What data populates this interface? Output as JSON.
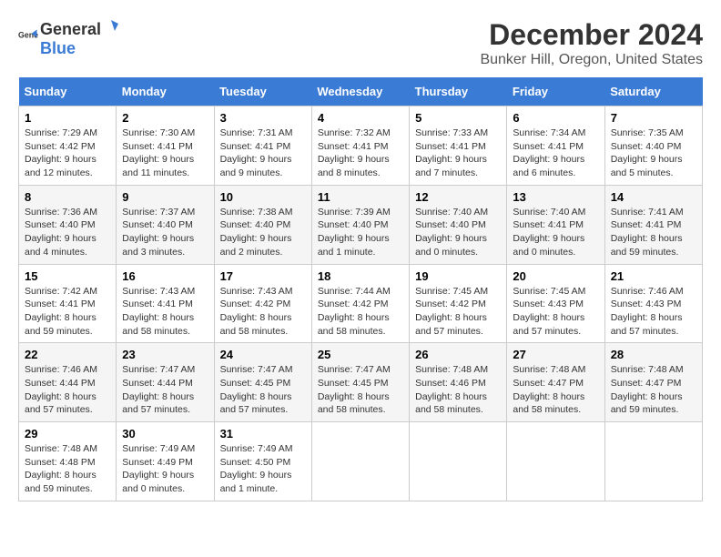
{
  "logo": {
    "text_general": "General",
    "text_blue": "Blue"
  },
  "title": "December 2024",
  "subtitle": "Bunker Hill, Oregon, United States",
  "days_of_week": [
    "Sunday",
    "Monday",
    "Tuesday",
    "Wednesday",
    "Thursday",
    "Friday",
    "Saturday"
  ],
  "weeks": [
    [
      {
        "day": "1",
        "sunrise": "Sunrise: 7:29 AM",
        "sunset": "Sunset: 4:42 PM",
        "daylight": "Daylight: 9 hours and 12 minutes."
      },
      {
        "day": "2",
        "sunrise": "Sunrise: 7:30 AM",
        "sunset": "Sunset: 4:41 PM",
        "daylight": "Daylight: 9 hours and 11 minutes."
      },
      {
        "day": "3",
        "sunrise": "Sunrise: 7:31 AM",
        "sunset": "Sunset: 4:41 PM",
        "daylight": "Daylight: 9 hours and 9 minutes."
      },
      {
        "day": "4",
        "sunrise": "Sunrise: 7:32 AM",
        "sunset": "Sunset: 4:41 PM",
        "daylight": "Daylight: 9 hours and 8 minutes."
      },
      {
        "day": "5",
        "sunrise": "Sunrise: 7:33 AM",
        "sunset": "Sunset: 4:41 PM",
        "daylight": "Daylight: 9 hours and 7 minutes."
      },
      {
        "day": "6",
        "sunrise": "Sunrise: 7:34 AM",
        "sunset": "Sunset: 4:41 PM",
        "daylight": "Daylight: 9 hours and 6 minutes."
      },
      {
        "day": "7",
        "sunrise": "Sunrise: 7:35 AM",
        "sunset": "Sunset: 4:40 PM",
        "daylight": "Daylight: 9 hours and 5 minutes."
      }
    ],
    [
      {
        "day": "8",
        "sunrise": "Sunrise: 7:36 AM",
        "sunset": "Sunset: 4:40 PM",
        "daylight": "Daylight: 9 hours and 4 minutes."
      },
      {
        "day": "9",
        "sunrise": "Sunrise: 7:37 AM",
        "sunset": "Sunset: 4:40 PM",
        "daylight": "Daylight: 9 hours and 3 minutes."
      },
      {
        "day": "10",
        "sunrise": "Sunrise: 7:38 AM",
        "sunset": "Sunset: 4:40 PM",
        "daylight": "Daylight: 9 hours and 2 minutes."
      },
      {
        "day": "11",
        "sunrise": "Sunrise: 7:39 AM",
        "sunset": "Sunset: 4:40 PM",
        "daylight": "Daylight: 9 hours and 1 minute."
      },
      {
        "day": "12",
        "sunrise": "Sunrise: 7:40 AM",
        "sunset": "Sunset: 4:40 PM",
        "daylight": "Daylight: 9 hours and 0 minutes."
      },
      {
        "day": "13",
        "sunrise": "Sunrise: 7:40 AM",
        "sunset": "Sunset: 4:41 PM",
        "daylight": "Daylight: 9 hours and 0 minutes."
      },
      {
        "day": "14",
        "sunrise": "Sunrise: 7:41 AM",
        "sunset": "Sunset: 4:41 PM",
        "daylight": "Daylight: 8 hours and 59 minutes."
      }
    ],
    [
      {
        "day": "15",
        "sunrise": "Sunrise: 7:42 AM",
        "sunset": "Sunset: 4:41 PM",
        "daylight": "Daylight: 8 hours and 59 minutes."
      },
      {
        "day": "16",
        "sunrise": "Sunrise: 7:43 AM",
        "sunset": "Sunset: 4:41 PM",
        "daylight": "Daylight: 8 hours and 58 minutes."
      },
      {
        "day": "17",
        "sunrise": "Sunrise: 7:43 AM",
        "sunset": "Sunset: 4:42 PM",
        "daylight": "Daylight: 8 hours and 58 minutes."
      },
      {
        "day": "18",
        "sunrise": "Sunrise: 7:44 AM",
        "sunset": "Sunset: 4:42 PM",
        "daylight": "Daylight: 8 hours and 58 minutes."
      },
      {
        "day": "19",
        "sunrise": "Sunrise: 7:45 AM",
        "sunset": "Sunset: 4:42 PM",
        "daylight": "Daylight: 8 hours and 57 minutes."
      },
      {
        "day": "20",
        "sunrise": "Sunrise: 7:45 AM",
        "sunset": "Sunset: 4:43 PM",
        "daylight": "Daylight: 8 hours and 57 minutes."
      },
      {
        "day": "21",
        "sunrise": "Sunrise: 7:46 AM",
        "sunset": "Sunset: 4:43 PM",
        "daylight": "Daylight: 8 hours and 57 minutes."
      }
    ],
    [
      {
        "day": "22",
        "sunrise": "Sunrise: 7:46 AM",
        "sunset": "Sunset: 4:44 PM",
        "daylight": "Daylight: 8 hours and 57 minutes."
      },
      {
        "day": "23",
        "sunrise": "Sunrise: 7:47 AM",
        "sunset": "Sunset: 4:44 PM",
        "daylight": "Daylight: 8 hours and 57 minutes."
      },
      {
        "day": "24",
        "sunrise": "Sunrise: 7:47 AM",
        "sunset": "Sunset: 4:45 PM",
        "daylight": "Daylight: 8 hours and 57 minutes."
      },
      {
        "day": "25",
        "sunrise": "Sunrise: 7:47 AM",
        "sunset": "Sunset: 4:45 PM",
        "daylight": "Daylight: 8 hours and 58 minutes."
      },
      {
        "day": "26",
        "sunrise": "Sunrise: 7:48 AM",
        "sunset": "Sunset: 4:46 PM",
        "daylight": "Daylight: 8 hours and 58 minutes."
      },
      {
        "day": "27",
        "sunrise": "Sunrise: 7:48 AM",
        "sunset": "Sunset: 4:47 PM",
        "daylight": "Daylight: 8 hours and 58 minutes."
      },
      {
        "day": "28",
        "sunrise": "Sunrise: 7:48 AM",
        "sunset": "Sunset: 4:47 PM",
        "daylight": "Daylight: 8 hours and 59 minutes."
      }
    ],
    [
      {
        "day": "29",
        "sunrise": "Sunrise: 7:48 AM",
        "sunset": "Sunset: 4:48 PM",
        "daylight": "Daylight: 8 hours and 59 minutes."
      },
      {
        "day": "30",
        "sunrise": "Sunrise: 7:49 AM",
        "sunset": "Sunset: 4:49 PM",
        "daylight": "Daylight: 9 hours and 0 minutes."
      },
      {
        "day": "31",
        "sunrise": "Sunrise: 7:49 AM",
        "sunset": "Sunset: 4:50 PM",
        "daylight": "Daylight: 9 hours and 1 minute."
      },
      null,
      null,
      null,
      null
    ]
  ]
}
